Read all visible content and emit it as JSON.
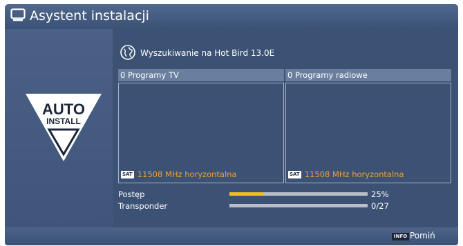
{
  "header": {
    "title": "Asystent instalacji"
  },
  "logo": {
    "line1": "AUTO",
    "line2": "INSTALL"
  },
  "scan": {
    "title": "Wyszukiwanie na Hot Bird 13.0E",
    "tv_column": {
      "header": "0 Programy TV",
      "frequency": "11508 MHz horyzontalna"
    },
    "radio_column": {
      "header": "0 Programy radiowe",
      "frequency": "11508 MHz horyzontalna"
    },
    "sat_badge": "SAT",
    "progress": {
      "label": "Postęp",
      "value_text": "25%",
      "fraction": 0.25
    },
    "transponder": {
      "label": "Transponder",
      "value_text": "0/27",
      "fraction": 0
    }
  },
  "footer": {
    "info_key": "INFO",
    "skip_label": "Pomiń"
  },
  "colors": {
    "accent": "#f0a030",
    "bar_fill": "#f0c020",
    "background": "#3b5275"
  }
}
